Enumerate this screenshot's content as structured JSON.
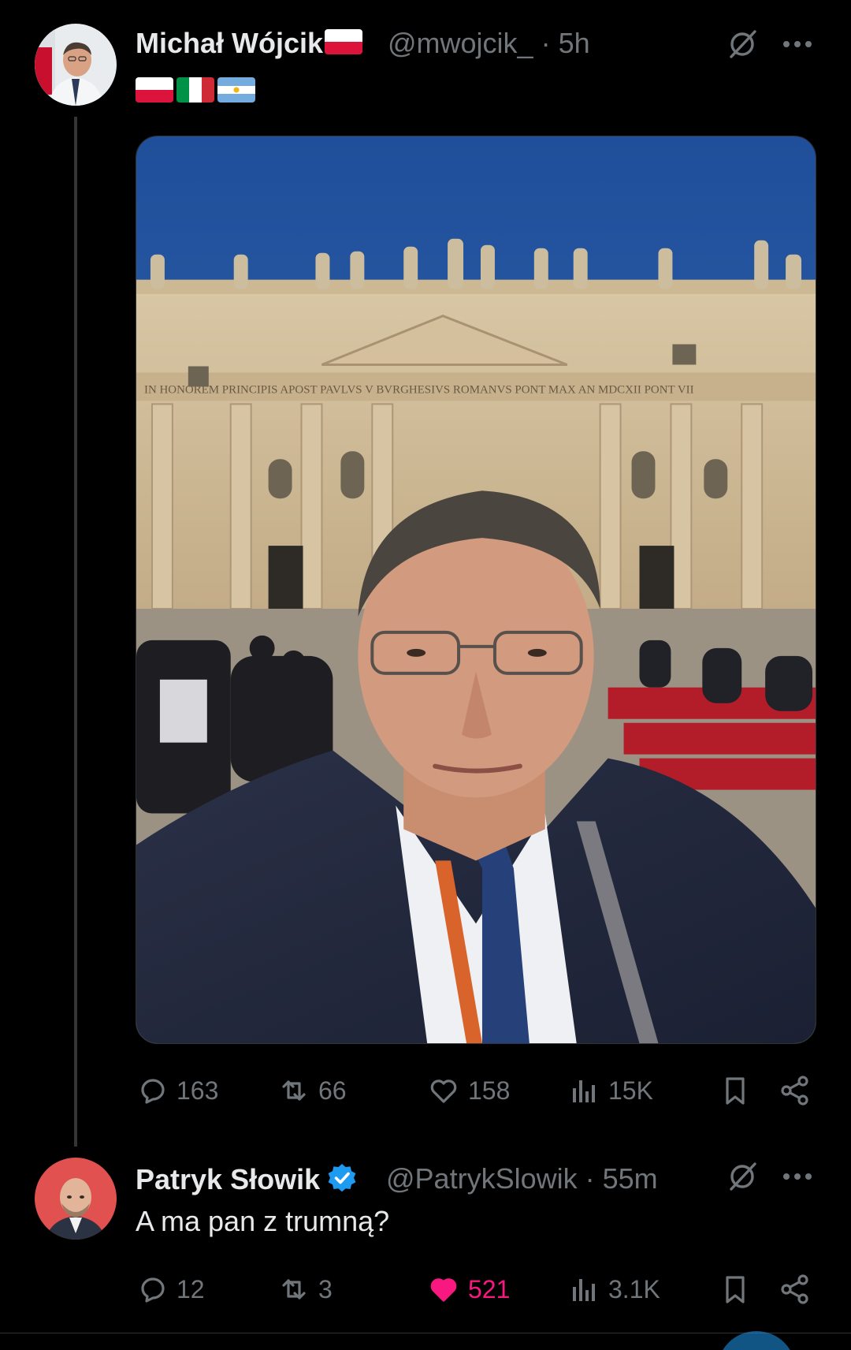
{
  "tweet": {
    "author_name": "Michał Wójcik",
    "handle": "@mwojcik_",
    "separator": "·",
    "time": "5h",
    "flags": [
      "poland",
      "italy",
      "argentina"
    ],
    "image_alt": "Selfie in front of St. Peter's Basilica",
    "facade_text": "IN HONOREM PRINCIPIS APOST PAVLVS V BVRGHESIVS ROMANVS PONT MAX AN MDCXII PONT VII",
    "stats": {
      "replies": "163",
      "reposts": "66",
      "likes": "158",
      "views": "15K"
    }
  },
  "reply": {
    "author_name": "Patryk Słowik",
    "handle": "@PatrykSlowik",
    "separator": "·",
    "time": "55m",
    "text": "A ma pan z trumną?",
    "stats": {
      "replies": "12",
      "reposts": "3",
      "likes": "521",
      "views": "3.1K"
    }
  },
  "colors": {
    "background": "#000000",
    "text": "#e7e9ea",
    "muted": "#71767b",
    "like_active": "#f91880",
    "verified": "#1d9bf0"
  },
  "icons": [
    "grok-icon",
    "more-icon",
    "reply-icon",
    "repost-icon",
    "like-icon",
    "views-icon",
    "bookmark-icon",
    "share-icon"
  ]
}
